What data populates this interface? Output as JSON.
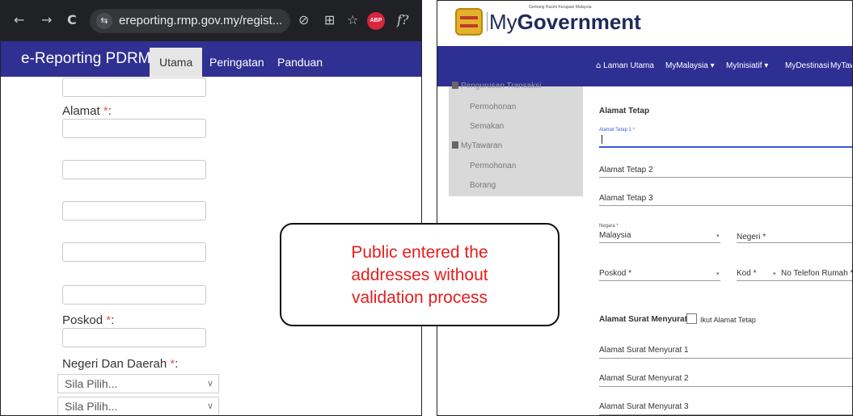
{
  "left_panel": {
    "browser": {
      "url": "ereporting.rmp.gov.my/regist...",
      "back_glyph": "←",
      "forward_glyph": "→",
      "reload_glyph": "C",
      "tune_glyph": "⇆",
      "eye_glyph": "⊘",
      "translate_glyph": "⊞",
      "star_glyph": "☆",
      "abp_label": "ABP",
      "ext_glyph": "f?"
    },
    "nav": {
      "brand": "e-Reporting PDRM",
      "tabs": [
        "Utama",
        "Peringatan",
        "Panduan"
      ],
      "active_tab": "Utama"
    },
    "form": {
      "alamat_label": "Alamat",
      "poskod_label": "Poskod",
      "negeri_label": "Negeri Dan Daerah",
      "required_mark": "*",
      "colon": ":",
      "select_placeholder": "Sila Pilih...",
      "chevron": "∨"
    }
  },
  "right_panel": {
    "header": {
      "tagline": "Gerbang Rasmi Kerajaan Malaysia",
      "logo_my": "My",
      "logo_gov": "Government"
    },
    "nav": {
      "items": [
        "Laman Utama",
        "MyMalaysia ▾",
        "MyInisiatif ▾",
        "MyDestinasi",
        "MyTawaran"
      ],
      "home_glyph": "⌂"
    },
    "sidebar": {
      "cut_off_title": "Pengurusan Transaksi",
      "items": [
        "Permohonan",
        "Semakan",
        "MyTawaran",
        "Permohonan",
        "Borang"
      ]
    },
    "form": {
      "section_title": "Alamat Tetap",
      "alamat_tetap_1_label": "Alamat Tetap 1 *",
      "alamat_tetap_2": "Alamat Tetap 2",
      "alamat_tetap_3": "Alamat Tetap 3",
      "negara_label": "Negara *",
      "negara_value": "Malaysia",
      "negeri_label": "Negeri *",
      "poskod_label": "Poskod *",
      "kod_label": "Kod *",
      "telefon_label": "No Telefon Rumah *",
      "surat_title": "Alamat Surat Menyurat",
      "ikut_label": "Ikut Alamat Tetap",
      "surat_1": "Alamat Surat Menyurat 1",
      "surat_2": "Alamat Surat Menyurat 2",
      "surat_3": "Alamat Surat Menyurat 3",
      "dropdown_glyph": "▾"
    }
  },
  "callout": {
    "lines": [
      "Public entered  the",
      "addresses without",
      "validation process"
    ]
  },
  "colors": {
    "pdrm_nav": "#2f3091",
    "mygov_nav": "#2d2f93",
    "callout_text": "#e31e1e",
    "chrome_bg": "#202124"
  }
}
